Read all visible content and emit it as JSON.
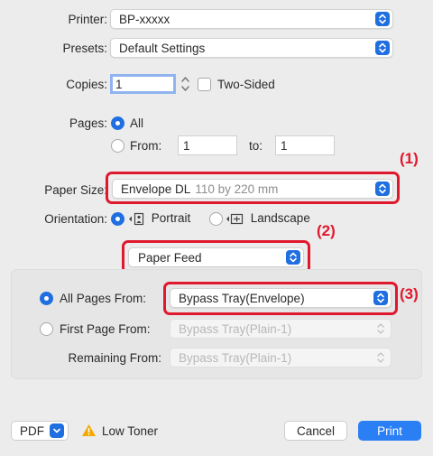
{
  "printer": {
    "label": "Printer:",
    "value": "BP-xxxxx"
  },
  "presets": {
    "label": "Presets:",
    "value": "Default Settings"
  },
  "copies": {
    "label": "Copies:",
    "value": "1",
    "two_sided_label": "Two-Sided",
    "two_sided_checked": false
  },
  "pages": {
    "label": "Pages:",
    "all_label": "All",
    "from_label": "From:",
    "from_value": "1",
    "to_label": "to:",
    "to_value": "1",
    "selected": "All"
  },
  "paper_size": {
    "label": "Paper Size:",
    "value": "Envelope DL",
    "detail": "110 by 220 mm"
  },
  "orientation": {
    "label": "Orientation:",
    "portrait_label": "Portrait",
    "landscape_label": "Landscape",
    "selected": "Portrait"
  },
  "section_popup": {
    "value": "Paper Feed"
  },
  "paper_feed": {
    "all_pages_label": "All Pages From:",
    "all_pages_value": "Bypass Tray(Envelope)",
    "first_page_label": "First Page From:",
    "first_page_value": "Bypass Tray(Plain-1)",
    "remaining_label": "Remaining From:",
    "remaining_value": "Bypass Tray(Plain-1)",
    "selected": "All Pages From"
  },
  "footer": {
    "pdf_label": "PDF",
    "warning_label": "Low Toner",
    "cancel_label": "Cancel",
    "print_label": "Print"
  },
  "callouts": {
    "c1": "(1)",
    "c2": "(2)",
    "c3": "(3)"
  },
  "colors": {
    "accent": "#1f6fe0",
    "highlight": "#e0182d",
    "warning": "#f2a900"
  }
}
